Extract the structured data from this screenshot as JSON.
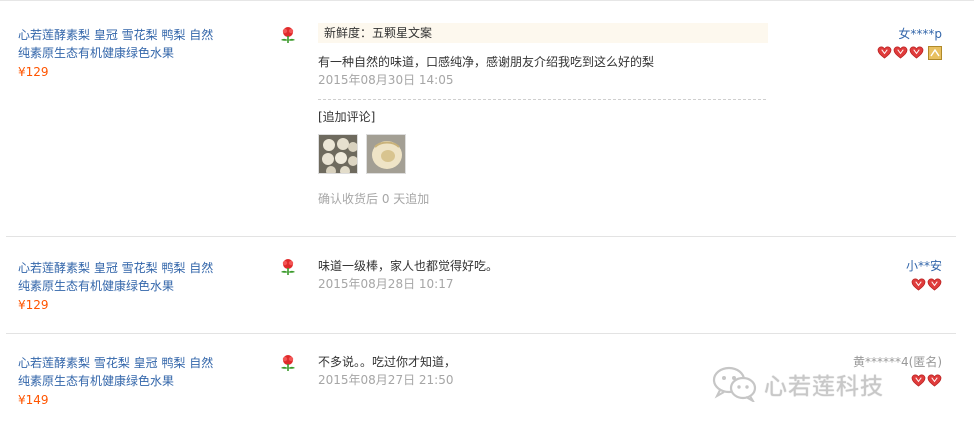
{
  "reviews": [
    {
      "product": {
        "title_line1": "心若莲酵素梨 皇冠 雪花梨 鸭梨 自然",
        "title_line2": "纯素原生态有机健康绿色水果",
        "price": "¥129"
      },
      "freshness": "新鲜度：五颗星文案",
      "comment": "有一种自然的味道，口感纯净，感谢朋友介绍我吃到这么好的梨",
      "date": "2015年08月30日 14:05",
      "followup_label": "[追加评论]",
      "followup_note": "确认收货后 0 天追加",
      "user": {
        "name": "女****p",
        "hearts": 3,
        "extra_badge": true
      }
    },
    {
      "product": {
        "title_line1": "心若莲酵素梨 皇冠 雪花梨 鸭梨 自然",
        "title_line2": "纯素原生态有机健康绿色水果",
        "price": "¥129"
      },
      "comment": "味道一级棒，家人也都觉得好吃。",
      "date": "2015年08月28日 10:17",
      "user": {
        "name": "小**安",
        "hearts": 2
      }
    },
    {
      "product": {
        "title_line1": "心若莲酵素梨 雪花梨 皇冠 鸭梨 自然",
        "title_line2": "纯素原生态有机健康绿色水果",
        "price": "¥149"
      },
      "comment": "不多说。。吃过你才知道，",
      "date": "2015年08月27日 21:50",
      "user": {
        "name": "黄******4(匿名)",
        "hearts": 2
      }
    }
  ],
  "watermark": {
    "text": "心若莲科技",
    "icon": "wechat-icon"
  },
  "colors": {
    "link": "#3366aa",
    "price": "#ff5500",
    "heart": "#e03c3c",
    "date": "#a6a6a6"
  }
}
